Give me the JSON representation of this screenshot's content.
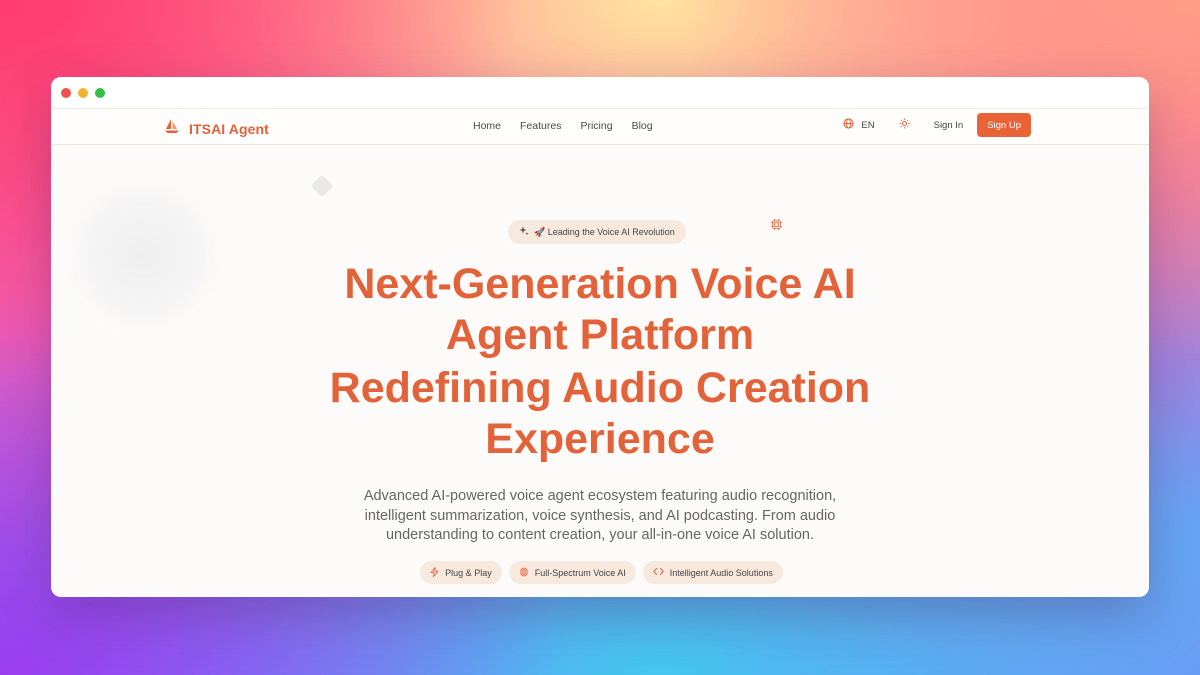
{
  "brand": {
    "name": "ITSAI Agent",
    "icon": "sailboat-icon"
  },
  "nav": {
    "links": [
      "Home",
      "Features",
      "Pricing",
      "Blog"
    ],
    "language": "EN",
    "sign_in": "Sign In",
    "sign_up": "Sign Up"
  },
  "hero": {
    "badge": "🚀 Leading the Voice AI Revolution",
    "headline_1_line_1": "Next-Generation Voice AI",
    "headline_1_line_2": "Agent Platform",
    "headline_2_line_1": "Redefining Audio Creation",
    "headline_2_line_2": "Experience",
    "description_line_1": "Advanced AI-powered voice agent ecosystem featuring audio recognition,",
    "description_line_2": "intelligent summarization, voice synthesis, and AI podcasting. From audio",
    "description_line_3": "understanding to content creation, your all-in-one voice AI solution.",
    "pills": [
      {
        "label": "Plug & Play",
        "icon": "lightning-icon"
      },
      {
        "label": "Full-Spectrum Voice AI",
        "icon": "chip-icon"
      },
      {
        "label": "Intelligent Audio Solutions",
        "icon": "code-icon"
      }
    ]
  },
  "colors": {
    "accent": "#e2633a",
    "button": "#e96337",
    "pill_bg": "#f8e9de"
  }
}
